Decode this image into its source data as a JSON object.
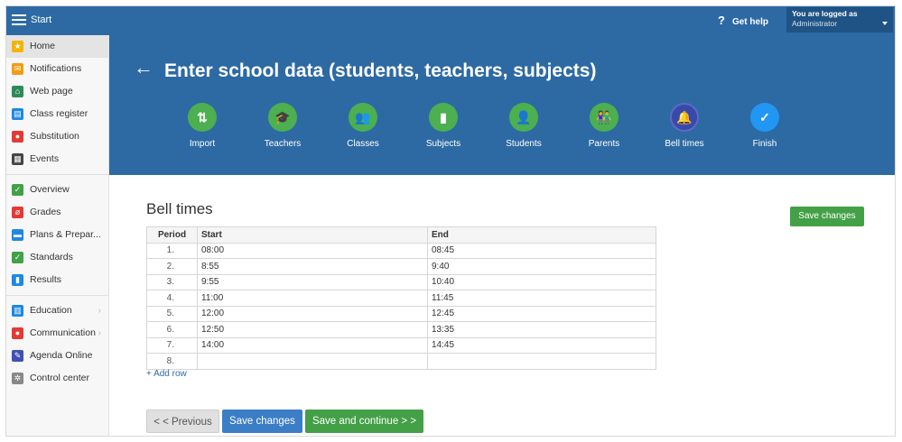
{
  "topbar": {
    "title": "Start",
    "help_label": "Get help",
    "help_icon": "?",
    "user_line1": "You are logged as",
    "user_line2": "Administrator"
  },
  "sidebar": {
    "items": [
      {
        "label": "Home",
        "icon": "star-icon",
        "color": "#f5b400",
        "glyph": "★",
        "active": true
      },
      {
        "label": "Notifications",
        "icon": "envelope-icon",
        "color": "#f39c12",
        "glyph": "✉"
      },
      {
        "label": "Web page",
        "icon": "house-icon",
        "color": "#2e8b57",
        "glyph": "⌂"
      },
      {
        "label": "Class register",
        "icon": "book-icon",
        "color": "#1e88e5",
        "glyph": "▤"
      },
      {
        "label": "Substitution",
        "icon": "person-icon",
        "color": "#e53935",
        "glyph": "●"
      },
      {
        "label": "Events",
        "icon": "calendar-icon",
        "color": "#444444",
        "glyph": "▦"
      },
      {
        "label": "Overview",
        "icon": "check-icon",
        "color": "#43a047",
        "glyph": "✓"
      },
      {
        "label": "Grades",
        "icon": "grades-icon",
        "color": "#e53935",
        "glyph": "ø"
      },
      {
        "label": "Plans & Prepar...",
        "icon": "plans-icon",
        "color": "#1e88e5",
        "glyph": "▬"
      },
      {
        "label": "Standards",
        "icon": "shield-icon",
        "color": "#43a047",
        "glyph": "✓"
      },
      {
        "label": "Results",
        "icon": "bar-chart-icon",
        "color": "#1e88e5",
        "glyph": "▮"
      },
      {
        "label": "Education",
        "icon": "education-icon",
        "color": "#1e88e5",
        "glyph": "▥",
        "chevron": true
      },
      {
        "label": "Communication",
        "icon": "chat-icon",
        "color": "#e53935",
        "glyph": "●",
        "chevron": true
      },
      {
        "label": "Agenda Online",
        "icon": "pen-icon",
        "color": "#3f51b5",
        "glyph": "✎"
      },
      {
        "label": "Control center",
        "icon": "gear-icon",
        "color": "#888888",
        "glyph": "✲"
      }
    ]
  },
  "header": {
    "back_glyph": "🡐",
    "title": "Enter school data (students, teachers, subjects)"
  },
  "steps": [
    {
      "label": "Import",
      "glyph": "⇅",
      "icon": "import-icon"
    },
    {
      "label": "Teachers",
      "glyph": "🎓",
      "icon": "graduation-cap-icon"
    },
    {
      "label": "Classes",
      "glyph": "👥",
      "icon": "group-icon"
    },
    {
      "label": "Subjects",
      "glyph": "▮",
      "icon": "book-icon"
    },
    {
      "label": "Students",
      "glyph": "👤",
      "icon": "user-icon"
    },
    {
      "label": "Parents",
      "glyph": "👫",
      "icon": "parents-icon"
    },
    {
      "label": "Bell times",
      "glyph": "🔔",
      "icon": "bell-icon"
    },
    {
      "label": "Finish",
      "glyph": "✓",
      "icon": "checkmark-icon"
    }
  ],
  "bell_times": {
    "title": "Bell times",
    "save_top_label": "Save changes",
    "columns": [
      "Period",
      "Start",
      "End"
    ],
    "rows": [
      {
        "period": "1.",
        "start": "08:00",
        "end": "08:45"
      },
      {
        "period": "2.",
        "start": "8:55",
        "end": "9:40"
      },
      {
        "period": "3.",
        "start": "9:55",
        "end": "10:40"
      },
      {
        "period": "4.",
        "start": "11:00",
        "end": "11:45"
      },
      {
        "period": "5.",
        "start": "12:00",
        "end": "12:45"
      },
      {
        "period": "6.",
        "start": "12:50",
        "end": "13:35"
      },
      {
        "period": "7.",
        "start": "14:00",
        "end": "14:45"
      },
      {
        "period": "8.",
        "start": "",
        "end": ""
      }
    ],
    "add_row_label": "+ Add row"
  },
  "footer": {
    "previous_label": "< < Previous",
    "save_label": "Save changes",
    "continue_label": "Save and continue > >"
  }
}
